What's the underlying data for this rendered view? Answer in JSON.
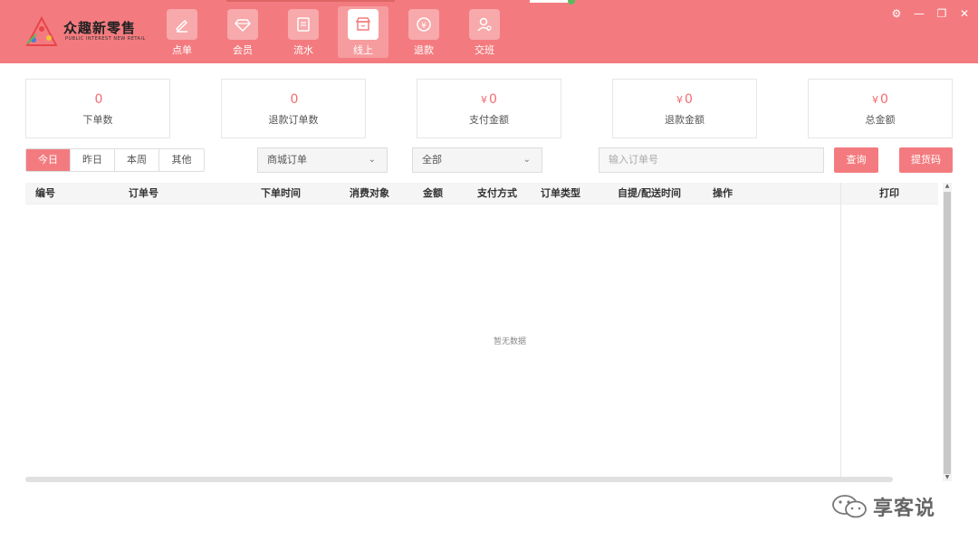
{
  "brand": {
    "name": "众趣新零售",
    "subtitle": "PUBLIC INTEREST NEW RETAIL"
  },
  "nav": [
    {
      "label": "点单",
      "icon": "pen-icon"
    },
    {
      "label": "会员",
      "icon": "diamond-icon"
    },
    {
      "label": "流水",
      "icon": "receipt-icon"
    },
    {
      "label": "线上",
      "icon": "store-icon",
      "active": true
    },
    {
      "label": "退款",
      "icon": "refund-icon"
    },
    {
      "label": "交班",
      "icon": "handover-icon"
    }
  ],
  "window_controls": {
    "settings": "⚙",
    "minimize": "—",
    "restore": "❐",
    "close": "✕"
  },
  "stats": [
    {
      "value": "0",
      "label": "下单数",
      "currency": ""
    },
    {
      "value": "0",
      "label": "退款订单数",
      "currency": ""
    },
    {
      "value": "0",
      "label": "支付金额",
      "currency": "¥"
    },
    {
      "value": "0",
      "label": "退款金额",
      "currency": "¥"
    },
    {
      "value": "0",
      "label": "总金额",
      "currency": "¥"
    }
  ],
  "filters": {
    "periods": [
      "今日",
      "昨日",
      "本周",
      "其他"
    ],
    "selected_period": "今日",
    "order_source": "商城订单",
    "status": "全部",
    "order_search_placeholder": "输入订单号",
    "query_button": "查询",
    "pickup_button": "提货码"
  },
  "table": {
    "columns": [
      "编号",
      "订单号",
      "下单时间",
      "消费对象",
      "金额",
      "支付方式",
      "订单类型",
      "自提/配送时间",
      "操作"
    ],
    "print_column": "打印",
    "rows": [],
    "empty_text": "暂无数据"
  },
  "watermark": "享客说",
  "colors": {
    "accent": "#f37b7f",
    "value": "#f36b70"
  }
}
